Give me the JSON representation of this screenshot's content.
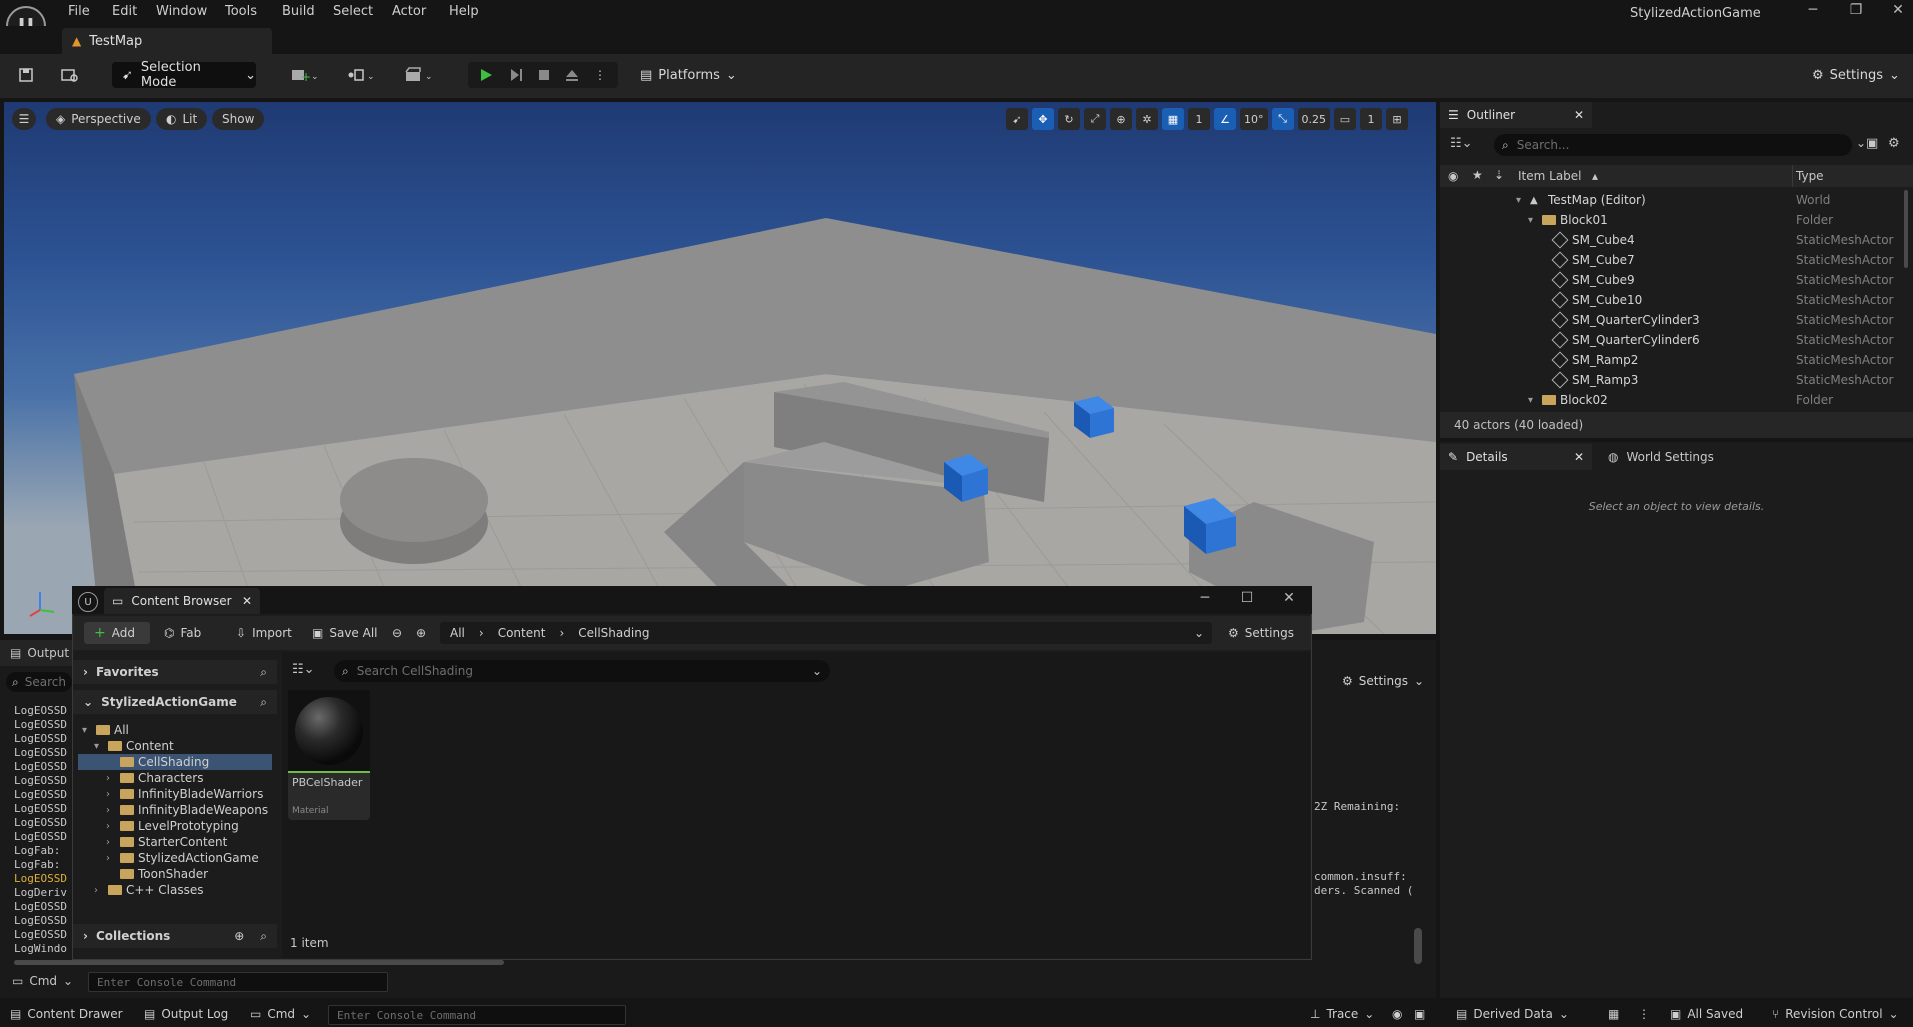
{
  "app": {
    "project_name": "StylizedActionGame",
    "menu": [
      "File",
      "Edit",
      "Window",
      "Tools",
      "Build",
      "Select",
      "Actor",
      "Help"
    ],
    "map_tab": "TestMap"
  },
  "toolbar": {
    "selection_mode": "Selection Mode",
    "platforms": "Platforms",
    "settings": "Settings"
  },
  "viewport": {
    "perspective": "Perspective",
    "lit": "Lit",
    "show": "Show",
    "grid_snap": "1",
    "rotation_snap": "10°",
    "scale_snap": "0.25",
    "camera_speed": "1"
  },
  "outliner": {
    "title": "Outliner",
    "search_placeholder": "Search...",
    "col_label": "Item Label",
    "col_type": "Type",
    "rows": [
      {
        "label": "TestMap (Editor)",
        "type": "World",
        "kind": "world"
      },
      {
        "label": "Block01",
        "type": "Folder",
        "kind": "folder"
      },
      {
        "label": "SM_Cube4",
        "type": "StaticMeshActor",
        "kind": "mesh"
      },
      {
        "label": "SM_Cube7",
        "type": "StaticMeshActor",
        "kind": "mesh"
      },
      {
        "label": "SM_Cube9",
        "type": "StaticMeshActor",
        "kind": "mesh"
      },
      {
        "label": "SM_Cube10",
        "type": "StaticMeshActor",
        "kind": "mesh"
      },
      {
        "label": "SM_QuarterCylinder3",
        "type": "StaticMeshActor",
        "kind": "mesh"
      },
      {
        "label": "SM_QuarterCylinder6",
        "type": "StaticMeshActor",
        "kind": "mesh"
      },
      {
        "label": "SM_Ramp2",
        "type": "StaticMeshActor",
        "kind": "mesh"
      },
      {
        "label": "SM_Ramp3",
        "type": "StaticMeshActor",
        "kind": "mesh"
      },
      {
        "label": "Block02",
        "type": "Folder",
        "kind": "folder"
      }
    ],
    "footer": "40 actors (40 loaded)"
  },
  "details": {
    "title": "Details",
    "world_settings": "World Settings",
    "empty_text": "Select an object to view details."
  },
  "output_log": {
    "tab": "Output",
    "search_placeholder": "Search",
    "settings": "Settings",
    "lines": [
      "LogEOSSD",
      "LogEOSSD",
      "LogEOSSD",
      "LogEOSSD",
      "LogEOSSD",
      "LogEOSSD",
      "LogEOSSD",
      "LogEOSSD",
      "LogEOSSD",
      "LogEOSSD",
      "LogFab:",
      "LogFab:",
      "LogEOSSD",
      "LogDeriv",
      "LogEOSSD",
      "LogEOSSD",
      "LogEOSSD",
      "LogWindo"
    ],
    "right_fragments": [
      "2Z Remaining: ",
      "common.insuff:",
      "ders. Scanned ("
    ]
  },
  "content_browser": {
    "title": "Content Browser",
    "add": "Add",
    "fab": "Fab",
    "import": "Import",
    "save_all": "Save All",
    "path": [
      "All",
      "Content",
      "CellShading"
    ],
    "settings": "Settings",
    "favorites": "Favorites",
    "project": "StylizedActionGame",
    "search_placeholder": "Search CellShading",
    "tree": [
      {
        "label": "All",
        "depth": 0
      },
      {
        "label": "Content",
        "depth": 1
      },
      {
        "label": "CellShading",
        "depth": 2
      },
      {
        "label": "Characters",
        "depth": 2
      },
      {
        "label": "InfinityBladeWarriors",
        "depth": 2
      },
      {
        "label": "InfinityBladeWeapons",
        "depth": 2
      },
      {
        "label": "LevelPrototyping",
        "depth": 2
      },
      {
        "label": "StarterContent",
        "depth": 2
      },
      {
        "label": "StylizedActionGame",
        "depth": 2
      },
      {
        "label": "ToonShader",
        "depth": 2
      },
      {
        "label": "C++ Classes",
        "depth": 1
      }
    ],
    "collections": "Collections",
    "asset": {
      "name": "PBCelShader",
      "type": "Material"
    },
    "item_count": "1 item"
  },
  "status_bar": {
    "content_drawer": "Content Drawer",
    "output_log": "Output Log",
    "cmd": "Cmd",
    "console_placeholder": "Enter Console Command",
    "trace": "Trace",
    "derived_data": "Derived Data",
    "all_saved": "All Saved",
    "revision_control": "Revision Control"
  }
}
